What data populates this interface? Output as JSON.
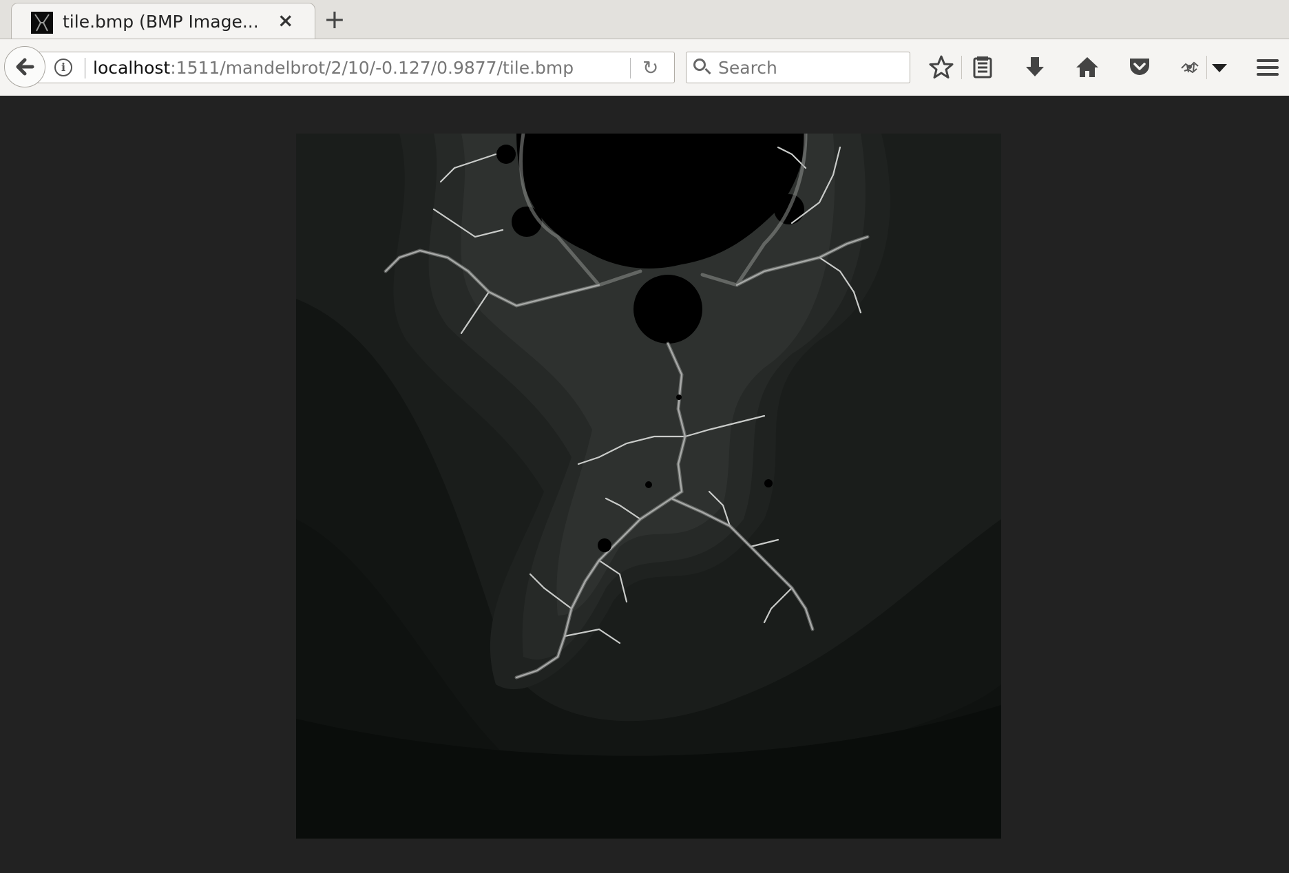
{
  "tab": {
    "title": "tile.bmp (BMP Image...",
    "close_glyph": "×",
    "favicon": "image-favicon-icon"
  },
  "newtab": {
    "glyph": "+"
  },
  "navbar": {
    "url_host": "localhost",
    "url_path": ":1511/mandelbrot/2/10/-0.127/0.9877/tile.bmp",
    "search_placeholder": "Search",
    "reload_glyph": "↻",
    "info_glyph": "i"
  },
  "toolbar": {
    "icons": [
      "bookmark-star-icon",
      "reading-list-icon",
      "download-icon",
      "home-icon",
      "pocket-icon",
      "extension-icon",
      "menu-icon"
    ]
  },
  "image": {
    "alt": "Mandelbrot tile",
    "bg_colors": [
      "#0a0d0b",
      "#111412",
      "#161917",
      "#1c1f1d",
      "#242725",
      "#2d302e"
    ],
    "fractal_color": "#c9cbc9"
  }
}
